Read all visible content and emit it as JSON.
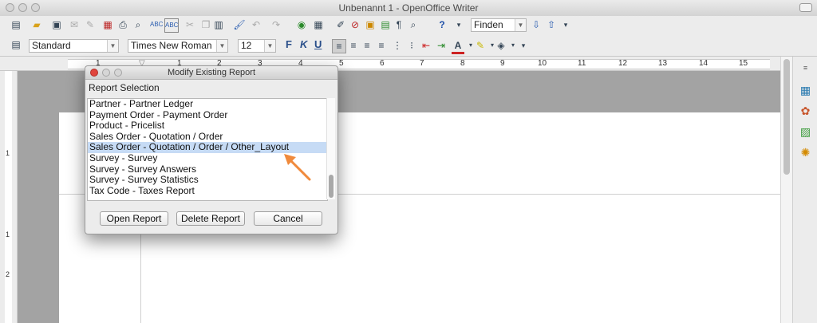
{
  "window": {
    "title": "Unbenannt 1 - OpenOffice Writer"
  },
  "toolbar": {
    "find_field": "Finden",
    "style": "Standard",
    "font": "Times New Roman",
    "size": "12",
    "bold": "F",
    "italic": "K",
    "underline": "U"
  },
  "ruler": {
    "numbers": [
      "1",
      "1",
      "2",
      "3",
      "4",
      "5",
      "6",
      "7",
      "8",
      "9",
      "10",
      "11",
      "12",
      "13",
      "14",
      "15"
    ]
  },
  "vruler": {
    "numbers": [
      "1",
      "1",
      "2"
    ]
  },
  "dialog": {
    "title": "Modify Existing Report",
    "label": "Report Selection",
    "items": [
      "Partner - Partner Ledger",
      "Payment Order - Payment Order",
      "Product - Pricelist",
      "Sales Order - Quotation / Order",
      "Sales Order - Quotation / Order / Other_Layout",
      "Survey - Survey",
      "Survey - Survey Answers",
      "Survey - Survey Statistics",
      "Tax Code - Taxes Report"
    ],
    "selected_index": 4,
    "buttons": {
      "open": "Open Report",
      "delete": "Delete Report",
      "cancel": "Cancel"
    }
  },
  "colors": {
    "selection": "#c6dbf5",
    "annotation_arrow": "#f08a3c"
  }
}
